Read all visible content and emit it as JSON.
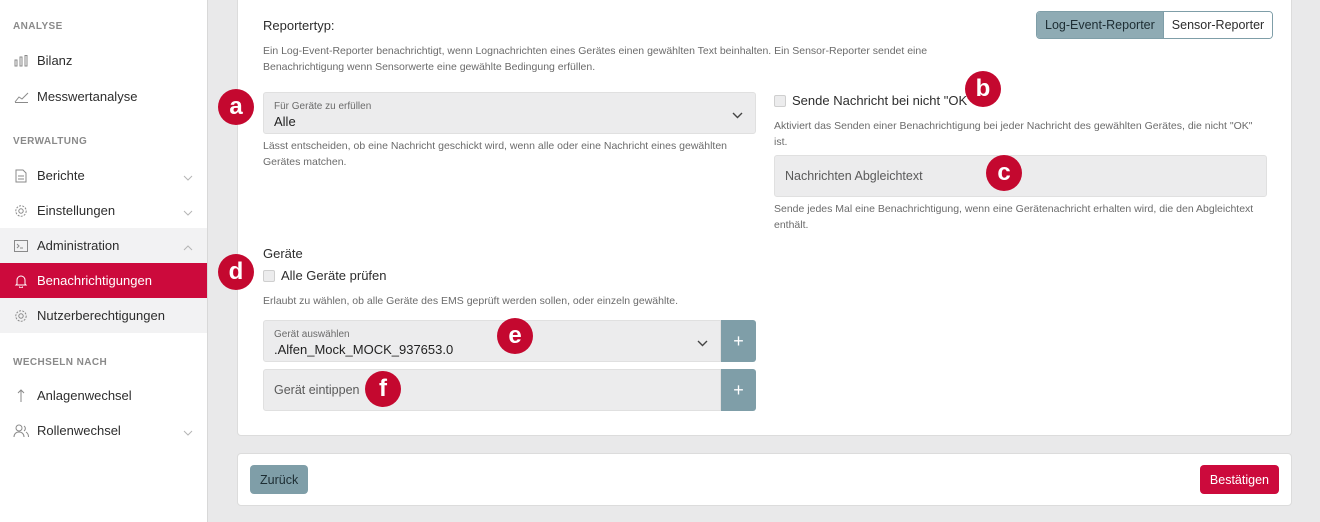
{
  "sidebar": {
    "sections": {
      "analyse": "ANALYSE",
      "verwaltung": "VERWALTUNG",
      "wechseln": "WECHSELN NACH"
    },
    "items": {
      "bilanz": "Bilanz",
      "messwertanalyse": "Messwertanalyse",
      "berichte": "Berichte",
      "einstellungen": "Einstellungen",
      "administration": "Administration",
      "benachrichtigungen": "Benachrichtigungen",
      "nutzerberechtigungen": "Nutzerberechtigungen",
      "anlagenwechsel": "Anlagenwechsel",
      "rollenwechsel": "Rollenwechsel"
    }
  },
  "form": {
    "reportertyp_label": "Reportertyp:",
    "reporter_toggle": {
      "log": "Log-Event-Reporter",
      "sensor": "Sensor-Reporter",
      "selected": "Log-Event-Reporter"
    },
    "reporter_help_1": "Ein Log-Event-Reporter benachrichtigt, wenn Lognachrichten eines Gerätes einen gewählten Text beinhalten. Ein Sensor-Reporter sendet eine",
    "reporter_help_2": "Benachrichtigung wenn Sensorwerte eine gewählte Bedingung erfüllen.",
    "condition_select": {
      "label": "Für Geräte zu erfüllen",
      "value": "Alle"
    },
    "condition_help_1": "Lässt entscheiden, ob eine Nachricht geschickt wird, wenn alle oder eine Nachricht eines gewählten",
    "condition_help_2": "Gerätes matchen.",
    "not_ok_checkbox": "Sende Nachricht bei nicht \"OK\"",
    "not_ok_help_1": "Aktiviert das Senden einer Benachrichtigung bei jeder Nachricht des gewählten Gerätes, die nicht \"OK\"",
    "not_ok_help_2": "ist.",
    "match_text_placeholder": "Nachrichten Abgleichtext",
    "match_text_help_1": "Sende jedes Mal eine Benachrichtigung, wenn eine Gerätenachricht erhalten wird, die den Abgleichtext",
    "match_text_help_2": "enthält.",
    "devices_label": "Geräte",
    "all_devices_checkbox": "Alle Geräte prüfen",
    "all_devices_help": "Erlaubt zu wählen, ob alle Geräte des EMS geprüft werden sollen, oder einzeln gewählte.",
    "device_select": {
      "label": "Gerät auswählen",
      "value": ".Alfen_Mock_MOCK_937653.0"
    },
    "device_input_placeholder": "Gerät eintippen",
    "plus": "+"
  },
  "footer": {
    "back": "Zurück",
    "confirm": "Bestätigen"
  },
  "markers": {
    "a": "a",
    "b": "b",
    "c": "c",
    "d": "d",
    "e": "e",
    "f": "f"
  },
  "colors": {
    "accent": "#cc0a3c",
    "secondary": "#7f9ea8",
    "field": "#ececed"
  }
}
